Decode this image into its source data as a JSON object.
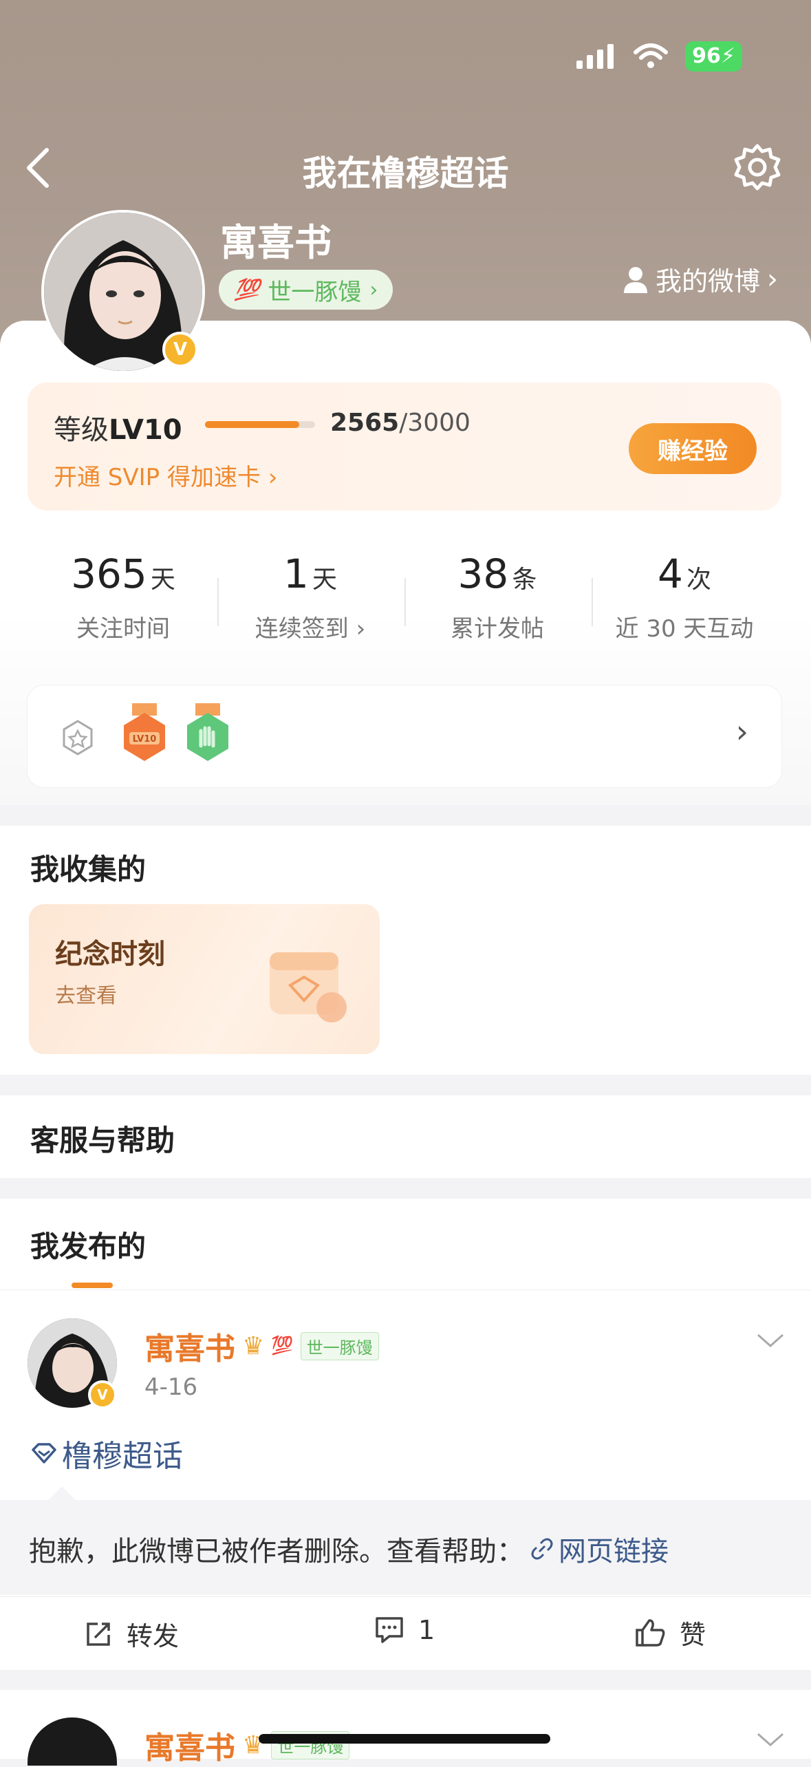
{
  "status_bar": {
    "battery": "96"
  },
  "nav": {
    "title": "我在橹穆超话",
    "back_icon": "chevron-left-icon",
    "settings_icon": "gear-icon"
  },
  "profile": {
    "name": "寓喜书",
    "tag": "世一豚馒",
    "my_weibo": "我的微博",
    "verified": "V"
  },
  "level": {
    "label": "等级",
    "level": "LV10",
    "current": "2565",
    "total": "/3000",
    "progress": 0.855,
    "svip_text": "开通 SVIP 得加速卡",
    "earn_button": "赚经验"
  },
  "stats": [
    {
      "num": "365",
      "unit": "天",
      "label": "关注时间"
    },
    {
      "num": "1",
      "unit": "天",
      "label": "连续签到"
    },
    {
      "num": "38",
      "unit": "条",
      "label": "累计发帖"
    },
    {
      "num": "4",
      "unit": "次",
      "label": "近 30 天互动"
    }
  ],
  "medals": {
    "lv_badge_text": "LV10"
  },
  "collection": {
    "title": "我收集的",
    "card_title": "纪念时刻",
    "card_sub": "去查看"
  },
  "help": {
    "title": "客服与帮助"
  },
  "posts": {
    "title": "我发布的",
    "items": [
      {
        "author": "寓喜书",
        "tag": "世一豚馒",
        "date": "4-16",
        "topic": "橹穆超话",
        "deleted_text": "抱歉，此微博已被作者删除。查看帮助：",
        "link_text": "网页链接",
        "repost": "转发",
        "comments": "1",
        "like": "赞"
      },
      {
        "author": "寓喜书",
        "tag": "世一豚馒"
      }
    ]
  },
  "colors": {
    "accent": "#f28a25",
    "link": "#3d5a8a",
    "green_tag": "#5cb85c"
  }
}
